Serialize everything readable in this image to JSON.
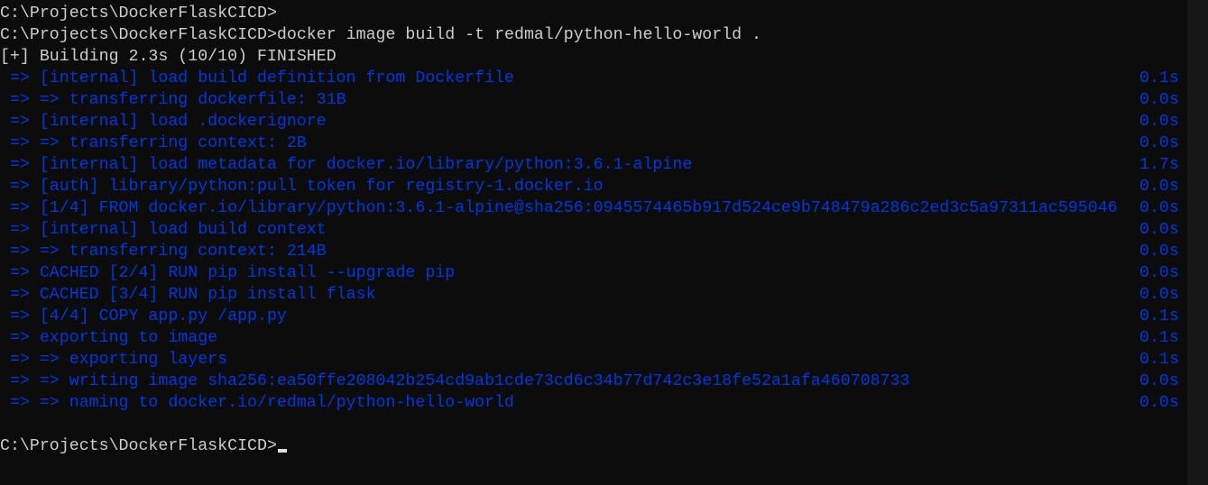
{
  "terminal": {
    "prompt": "C:\\Projects\\DockerFlaskCICD>",
    "command": "docker image build -t redmal/python-hello-world .",
    "build_status": "[+] Building 2.3s (10/10) FINISHED",
    "steps": [
      {
        "text": " => [internal] load build definition from Dockerfile",
        "time": "0.1s"
      },
      {
        "text": " => => transferring dockerfile: 31B",
        "time": "0.0s"
      },
      {
        "text": " => [internal] load .dockerignore",
        "time": "0.0s"
      },
      {
        "text": " => => transferring context: 2B",
        "time": "0.0s"
      },
      {
        "text": " => [internal] load metadata for docker.io/library/python:3.6.1-alpine",
        "time": "1.7s"
      },
      {
        "text": " => [auth] library/python:pull token for registry-1.docker.io",
        "time": "0.0s"
      },
      {
        "text": " => [1/4] FROM docker.io/library/python:3.6.1-alpine@sha256:0945574465b917d524ce9b748479a286c2ed3c5a97311ac595046",
        "time": "0.0s"
      },
      {
        "text": " => [internal] load build context",
        "time": "0.0s"
      },
      {
        "text": " => => transferring context: 214B",
        "time": "0.0s"
      },
      {
        "text": " => CACHED [2/4] RUN pip install --upgrade pip",
        "time": "0.0s"
      },
      {
        "text": " => CACHED [3/4] RUN pip install flask",
        "time": "0.0s"
      },
      {
        "text": " => [4/4] COPY app.py /app.py",
        "time": "0.1s"
      },
      {
        "text": " => exporting to image",
        "time": "0.1s"
      },
      {
        "text": " => => exporting layers",
        "time": "0.1s"
      },
      {
        "text": " => => writing image sha256:ea50ffe208042b254cd9ab1cde73cd6c34b77d742c3e18fe52a1afa460708733",
        "time": "0.0s"
      },
      {
        "text": " => => naming to docker.io/redmal/python-hello-world",
        "time": "0.0s"
      }
    ]
  }
}
